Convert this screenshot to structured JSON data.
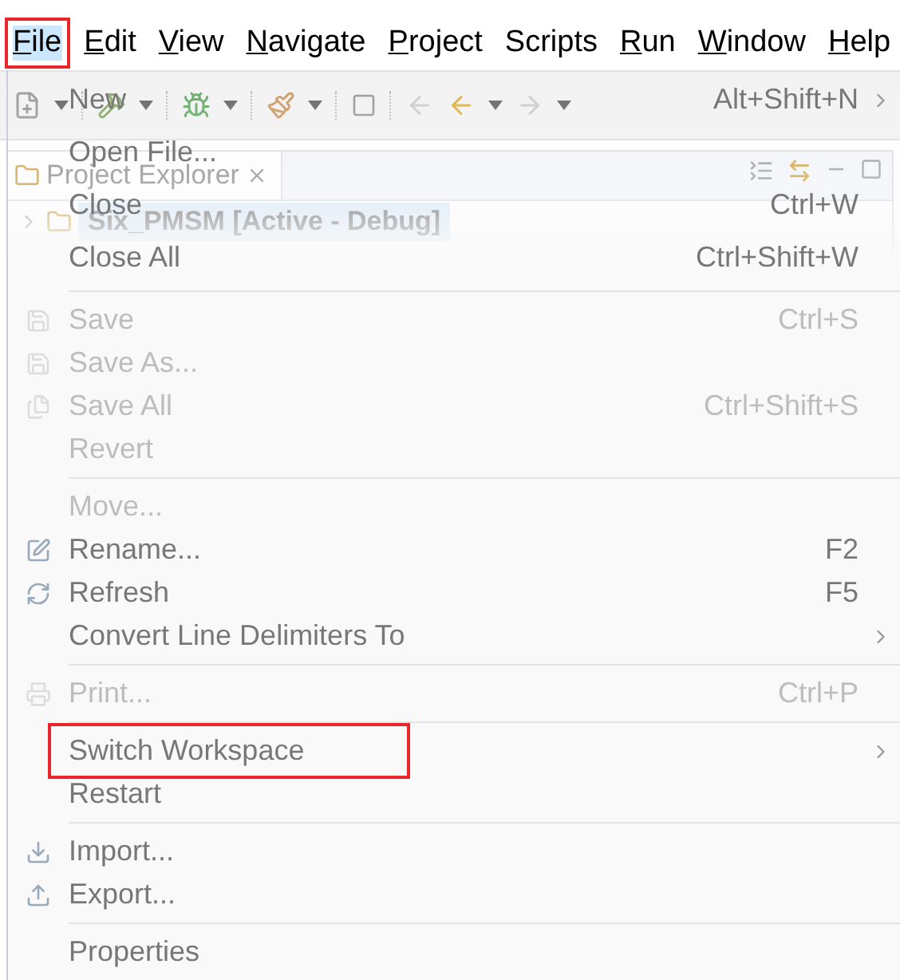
{
  "menu_bar": [
    {
      "label": "File",
      "mnemonic": true,
      "selected": true,
      "highlighted": true
    },
    {
      "label": "Edit",
      "mnemonic": true,
      "selected": false,
      "highlighted": false
    },
    {
      "label": "View",
      "mnemonic": true,
      "selected": false,
      "highlighted": false
    },
    {
      "label": "Navigate",
      "mnemonic": true,
      "selected": false,
      "highlighted": false
    },
    {
      "label": "Project",
      "mnemonic": true,
      "selected": false,
      "highlighted": false
    },
    {
      "label": "Scripts",
      "mnemonic": false,
      "selected": false,
      "highlighted": false
    },
    {
      "label": "Run",
      "mnemonic": true,
      "selected": false,
      "highlighted": false
    },
    {
      "label": "Window",
      "mnemonic": true,
      "selected": false,
      "highlighted": false
    },
    {
      "label": "Help",
      "mnemonic": true,
      "selected": false,
      "highlighted": false
    }
  ],
  "project_explorer": {
    "tab": "Project Explorer",
    "tree": [
      {
        "label": "Six_PMSM",
        "config": "[Active - Debug]",
        "selected": true,
        "expanded": false
      }
    ]
  },
  "file_menu": [
    {
      "kind": "item",
      "label": "New",
      "shortcut": "Alt+Shift+N",
      "disabled": false,
      "submenu": true,
      "highlighted": false
    },
    {
      "kind": "item",
      "label": "Open File...",
      "disabled": false,
      "submenu": false,
      "highlighted": false
    },
    {
      "kind": "item",
      "label": "Close",
      "shortcut": "Ctrl+W",
      "disabled": false,
      "submenu": false,
      "highlighted": false
    },
    {
      "kind": "item",
      "label": "Close All",
      "shortcut": "Ctrl+Shift+W",
      "disabled": false,
      "submenu": false,
      "highlighted": false
    },
    {
      "kind": "separator"
    },
    {
      "kind": "item",
      "label": "Save",
      "shortcut": "Ctrl+S",
      "disabled": true,
      "submenu": false,
      "highlighted": false
    },
    {
      "kind": "item",
      "label": "Save As...",
      "disabled": true,
      "submenu": false,
      "highlighted": false
    },
    {
      "kind": "item",
      "label": "Save All",
      "shortcut": "Ctrl+Shift+S",
      "disabled": true,
      "submenu": false,
      "highlighted": false
    },
    {
      "kind": "item",
      "label": "Revert",
      "disabled": true,
      "submenu": false,
      "highlighted": false
    },
    {
      "kind": "separator"
    },
    {
      "kind": "item",
      "label": "Move...",
      "disabled": true,
      "submenu": false,
      "highlighted": false
    },
    {
      "kind": "item",
      "label": "Rename...",
      "shortcut": "F2",
      "disabled": false,
      "submenu": false,
      "highlighted": false
    },
    {
      "kind": "item",
      "label": "Refresh",
      "shortcut": "F5",
      "disabled": false,
      "submenu": false,
      "highlighted": false
    },
    {
      "kind": "item",
      "label": "Convert Line Delimiters To",
      "disabled": false,
      "submenu": true,
      "highlighted": false
    },
    {
      "kind": "separator"
    },
    {
      "kind": "item",
      "label": "Print...",
      "shortcut": "Ctrl+P",
      "disabled": true,
      "submenu": false,
      "highlighted": false
    },
    {
      "kind": "separator"
    },
    {
      "kind": "item",
      "label": "Switch Workspace",
      "disabled": false,
      "submenu": true,
      "highlighted": true
    },
    {
      "kind": "item",
      "label": "Restart",
      "disabled": false,
      "submenu": false,
      "highlighted": false
    },
    {
      "kind": "separator"
    },
    {
      "kind": "item",
      "label": "Import...",
      "disabled": false,
      "submenu": false,
      "highlighted": false
    },
    {
      "kind": "item",
      "label": "Export...",
      "disabled": false,
      "submenu": false,
      "highlighted": false
    },
    {
      "kind": "separator"
    },
    {
      "kind": "item",
      "label": "Properties",
      "disabled": false,
      "submenu": false,
      "highlighted": false
    }
  ]
}
